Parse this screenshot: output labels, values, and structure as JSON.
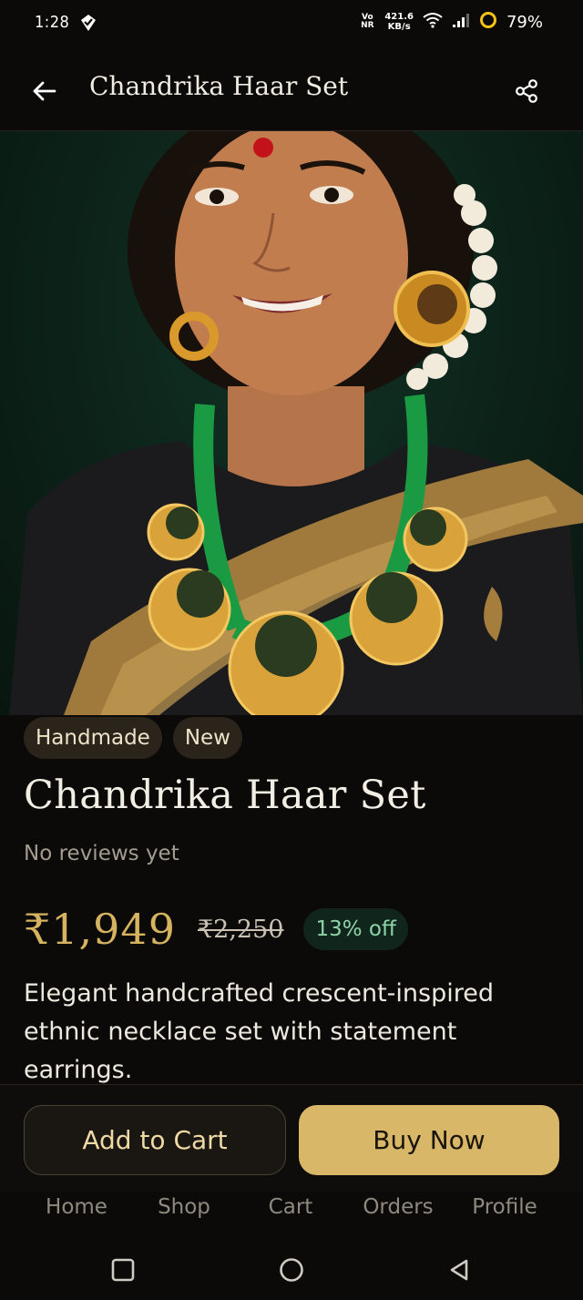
{
  "status_bar": {
    "time": "1:28",
    "network_label": "Vo NR",
    "speed_value": "421.6",
    "speed_unit": "KB/s",
    "battery": "79%"
  },
  "app_bar": {
    "title": "Chandrika Haar Set",
    "back_icon": "arrow-left-icon",
    "share_icon": "share-icon"
  },
  "product": {
    "badges": [
      "Handmade",
      "New"
    ],
    "title": "Chandrika Haar Set",
    "reviews": "No reviews yet",
    "price": "₹1,949",
    "mrp": "₹2,250",
    "discount": "13% off",
    "description": "Elegant handcrafted crescent-inspired ethnic necklace set with statement earrings."
  },
  "actions": {
    "add_to_cart": "Add to Cart",
    "buy_now": "Buy Now"
  },
  "bottom_nav": {
    "items": [
      "Home",
      "Shop",
      "Cart",
      "Orders",
      "Profile"
    ]
  },
  "colors": {
    "background": "#0b0a09",
    "accent_gold": "#d8b769",
    "price_gold": "#d6b35e",
    "discount_green": "#8fd4a6"
  }
}
